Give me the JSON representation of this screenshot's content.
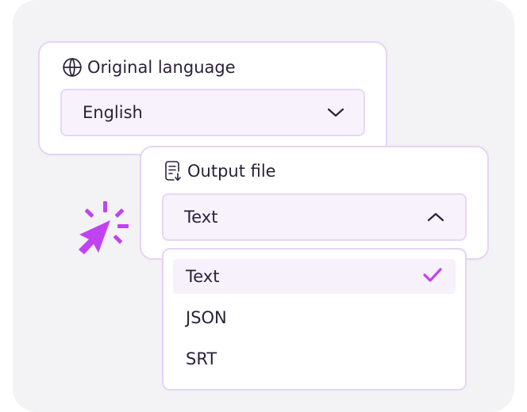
{
  "original_language": {
    "title": "Original language",
    "icon": "globe-icon",
    "value": "English",
    "chevron": "chevron-down-icon"
  },
  "output_file": {
    "title": "Output file",
    "icon": "document-download-icon",
    "value": "Text",
    "chevron": "chevron-up-icon",
    "options": [
      {
        "label": "Text",
        "selected": true
      },
      {
        "label": "JSON",
        "selected": false
      },
      {
        "label": "SRT",
        "selected": false
      }
    ]
  },
  "colors": {
    "accent": "#c043f2",
    "border": "#e6d3f6",
    "field_bg": "#f8f2fd",
    "text": "#2b2238",
    "background": "#f3f2f4"
  }
}
